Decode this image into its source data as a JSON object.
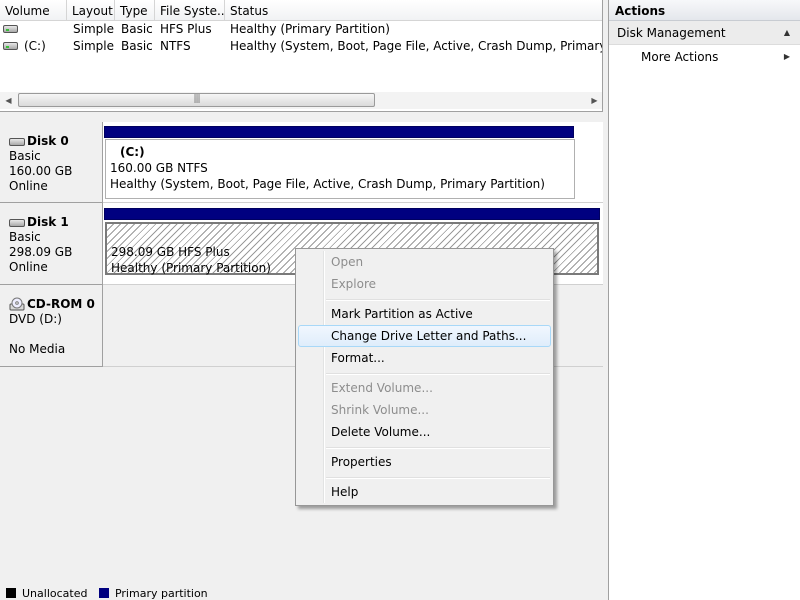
{
  "volume_list": {
    "columns": [
      "Volume",
      "Layout",
      "Type",
      "File Syste...",
      "Status"
    ],
    "rows": [
      {
        "volume": "",
        "layout": "Simple",
        "type": "Basic",
        "fs": "HFS Plus",
        "status": "Healthy (Primary Partition)"
      },
      {
        "volume": "(C:)",
        "layout": "Simple",
        "type": "Basic",
        "fs": "NTFS",
        "status": "Healthy (System, Boot, Page File, Active, Crash Dump, Primary Partition)"
      }
    ],
    "scroll_left": "◀",
    "scroll_right": "▶",
    "scroll_grip": "|||"
  },
  "disks": [
    {
      "name": "Disk 0",
      "type": "Basic",
      "size": "160.00 GB",
      "state": "Online",
      "partition": {
        "letter": "(C:)",
        "size_fs": "160.00 GB NTFS",
        "status": "Healthy (System, Boot, Page File, Active, Crash Dump, Primary Partition)"
      }
    },
    {
      "name": "Disk 1",
      "type": "Basic",
      "size": "298.09 GB",
      "state": "Online",
      "partition": {
        "letter": "",
        "size_fs": "298.09 GB HFS Plus",
        "status": "Healthy (Primary Partition)"
      }
    },
    {
      "name": "CD-ROM 0",
      "type": "DVD (D:)",
      "size": "",
      "state": "No Media"
    }
  ],
  "legend": {
    "items": [
      {
        "label": "Unallocated",
        "color": "#000000"
      },
      {
        "label": "Primary partition",
        "color": "#000080"
      }
    ]
  },
  "actions": {
    "title": "Actions",
    "group": "Disk Management",
    "group_caret": "▲",
    "more": "More Actions",
    "more_caret": "▶"
  },
  "context_menu": {
    "items": [
      {
        "label": "Open",
        "enabled": false
      },
      {
        "label": "Explore",
        "enabled": false
      },
      {
        "label": "Mark Partition as Active",
        "enabled": true
      },
      {
        "label": "Change Drive Letter and Paths...",
        "enabled": true,
        "highlighted": true
      },
      {
        "label": "Format...",
        "enabled": true
      },
      {
        "label": "Extend Volume...",
        "enabled": false
      },
      {
        "label": "Shrink Volume...",
        "enabled": false
      },
      {
        "label": "Delete Volume...",
        "enabled": true
      },
      {
        "label": "Properties",
        "enabled": true
      },
      {
        "label": "Help",
        "enabled": true
      }
    ]
  },
  "colors": {
    "primary_partition": "#000080",
    "menu_highlight": "#dfedfb",
    "disabled_text": "#8d8d8d"
  }
}
